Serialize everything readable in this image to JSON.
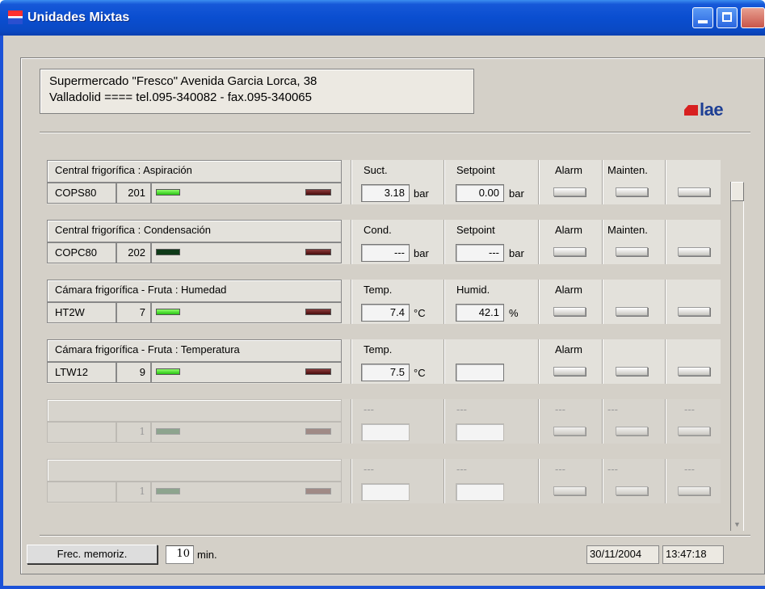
{
  "window": {
    "title": "Unidades Mixtas"
  },
  "header": {
    "line1": "Supermercado \"Fresco\" Avenida Garcia Lorca, 38",
    "line2": "Valladolid  ====   tel.095-340082 - fax.095-340065",
    "logo_text": "lae"
  },
  "colors": {
    "title_bar": "#0a4ed0",
    "led_on": "#29c414",
    "led_off": "#0e3a18",
    "led_alarm": "#4a0c0c",
    "panel_bg": "#d4d0c8"
  },
  "rows": [
    {
      "name": "Central frigorífica : Aspiración",
      "code": "COPS80",
      "address": "201",
      "status_led": "on",
      "p1": {
        "header": "Suct.",
        "value": "3.18",
        "unit": "bar"
      },
      "p2": {
        "header": "Setpoint",
        "value": "0.00",
        "unit": "bar"
      },
      "a1": "Alarm",
      "a2": "Mainten.",
      "a3": ""
    },
    {
      "name": "Central frigorífica : Condensación",
      "code": "COPC80",
      "address": "202",
      "status_led": "off",
      "p1": {
        "header": "Cond.",
        "value": "---",
        "unit": "bar"
      },
      "p2": {
        "header": "Setpoint",
        "value": "---",
        "unit": "bar"
      },
      "a1": "Alarm",
      "a2": "Mainten.",
      "a3": ""
    },
    {
      "name": "Cámara frigorífica - Fruta : Humedad",
      "code": "HT2W",
      "address": "7",
      "status_led": "on",
      "p1": {
        "header": "Temp.",
        "value": "7.4",
        "unit": "°C"
      },
      "p2": {
        "header": "Humid.",
        "value": "42.1",
        "unit": "%"
      },
      "a1": "Alarm",
      "a2": "",
      "a3": ""
    },
    {
      "name": "Cámara frigorífica - Fruta : Temperatura",
      "code": "LTW12",
      "address": "9",
      "status_led": "on",
      "p1": {
        "header": "Temp.",
        "value": "7.5",
        "unit": "°C"
      },
      "p2": {
        "header": "",
        "value": "",
        "unit": ""
      },
      "a1": "Alarm",
      "a2": "",
      "a3": ""
    },
    {
      "name": "",
      "code": "",
      "address": "1",
      "status_led": "disabled",
      "p1": {
        "header": "---",
        "value": "",
        "unit": ""
      },
      "p2": {
        "header": "---",
        "value": "",
        "unit": ""
      },
      "a1": "---",
      "a2": "---",
      "a3": "---"
    },
    {
      "name": "",
      "code": "",
      "address": "1",
      "status_led": "disabled",
      "p1": {
        "header": "---",
        "value": "",
        "unit": ""
      },
      "p2": {
        "header": "---",
        "value": "",
        "unit": ""
      },
      "a1": "---",
      "a2": "---",
      "a3": "---"
    }
  ],
  "footer": {
    "frec_button": "Frec. memoriz.",
    "frec_value": "10",
    "frec_unit": "min.",
    "date": "30/11/2004",
    "time": "13:47:18"
  }
}
